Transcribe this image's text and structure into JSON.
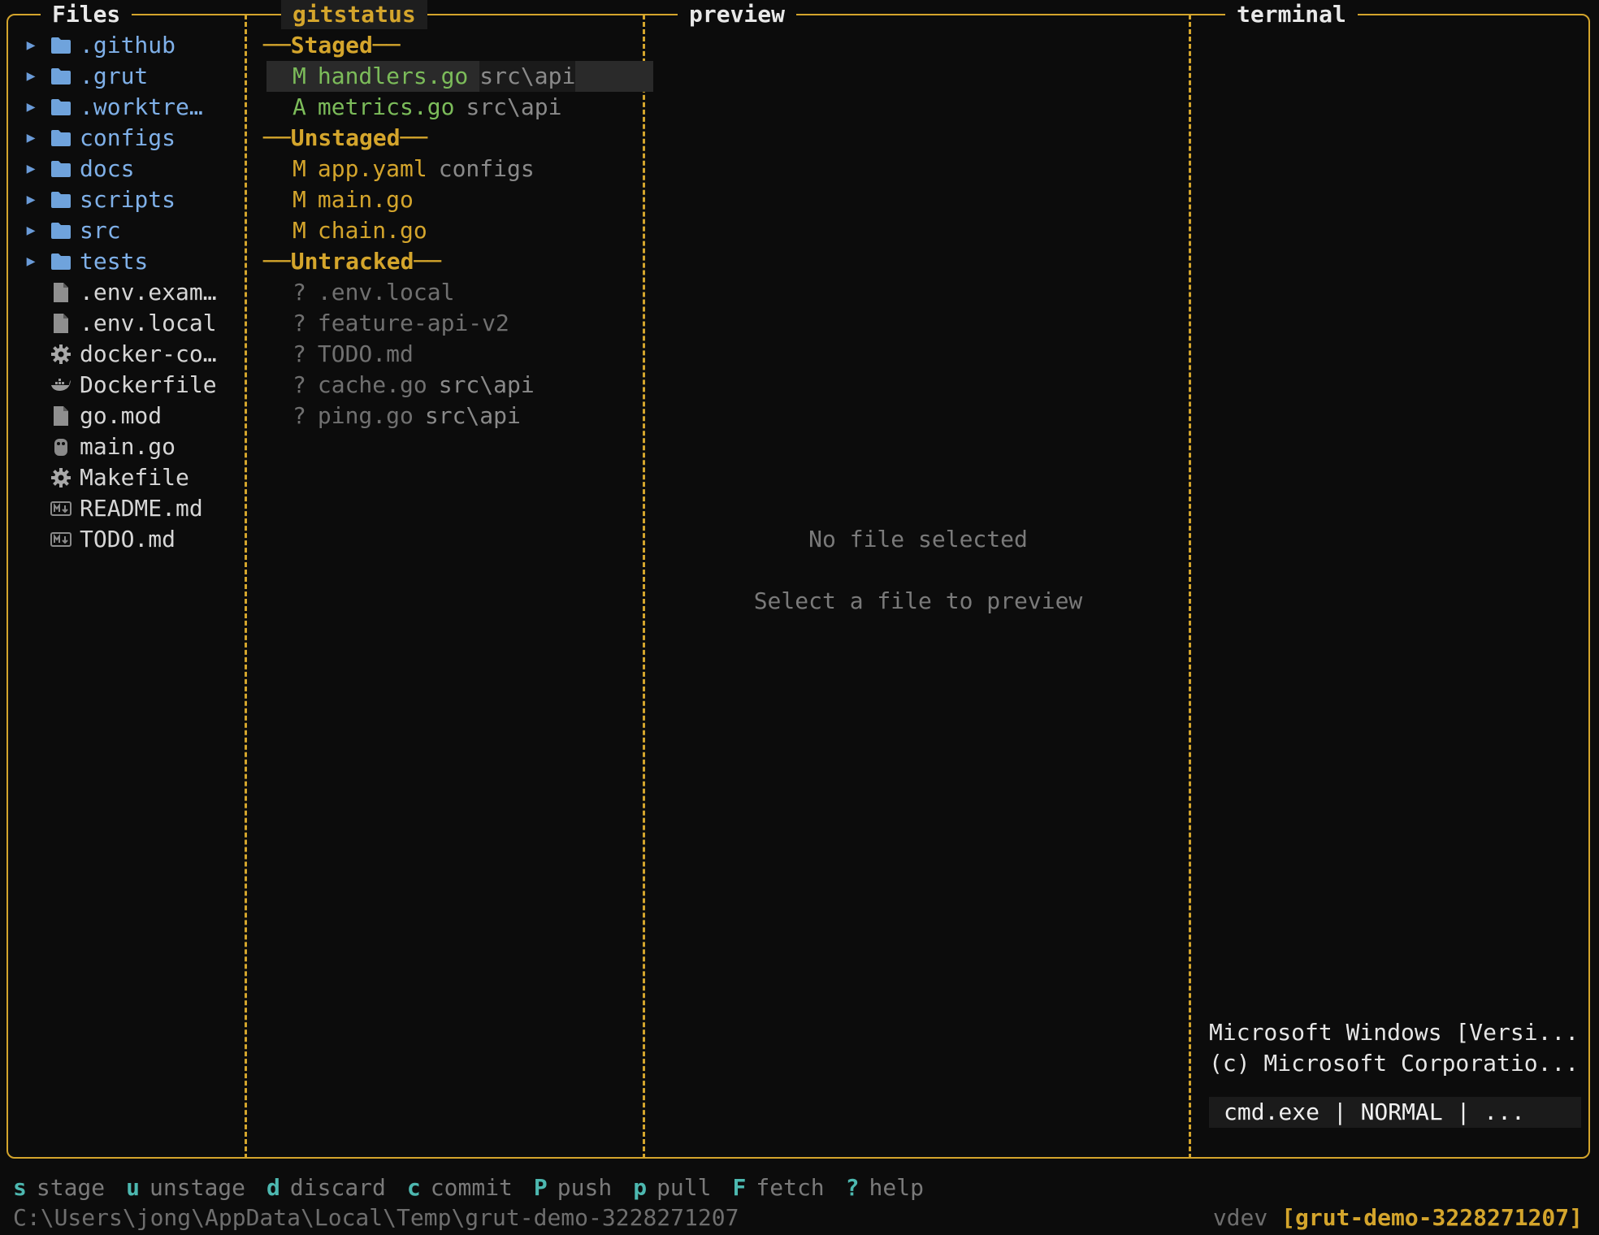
{
  "panes": {
    "files_title": "Files",
    "git_title": "gitstatus",
    "preview_title": "preview",
    "terminal_title": "terminal"
  },
  "files": [
    {
      "name": ".github",
      "kind": "dir",
      "icon": "folder-icon"
    },
    {
      "name": ".grut",
      "kind": "dir",
      "icon": "folder-icon"
    },
    {
      "name": ".worktre…",
      "kind": "dir",
      "icon": "folder-icon"
    },
    {
      "name": "configs",
      "kind": "dir",
      "icon": "folder-icon"
    },
    {
      "name": "docs",
      "kind": "dir",
      "icon": "folder-icon"
    },
    {
      "name": "scripts",
      "kind": "dir",
      "icon": "folder-icon"
    },
    {
      "name": "src",
      "kind": "dir",
      "icon": "folder-icon"
    },
    {
      "name": "tests",
      "kind": "dir",
      "icon": "folder-icon"
    },
    {
      "name": ".env.exam…",
      "kind": "file",
      "icon": "file-icon"
    },
    {
      "name": ".env.local",
      "kind": "file",
      "icon": "file-icon"
    },
    {
      "name": "docker-co…",
      "kind": "file",
      "icon": "gear-icon"
    },
    {
      "name": "Dockerfile",
      "kind": "file",
      "icon": "docker-icon"
    },
    {
      "name": "go.mod",
      "kind": "file",
      "icon": "file-icon"
    },
    {
      "name": "main.go",
      "kind": "file",
      "icon": "go-icon"
    },
    {
      "name": "Makefile",
      "kind": "file",
      "icon": "gear-icon"
    },
    {
      "name": "README.md",
      "kind": "file",
      "icon": "markdown-icon"
    },
    {
      "name": "TODO.md",
      "kind": "file",
      "icon": "markdown-icon"
    }
  ],
  "git": {
    "staged_header": "Staged",
    "unstaged_header": "Unstaged",
    "untracked_header": "Untracked",
    "staged": [
      {
        "status": "M",
        "name": "handlers.go",
        "path": "src\\api"
      },
      {
        "status": "A",
        "name": "metrics.go",
        "path": "src\\api"
      }
    ],
    "unstaged": [
      {
        "status": "M",
        "name": "app.yaml",
        "path": "configs"
      },
      {
        "status": "M",
        "name": "main.go",
        "path": ""
      },
      {
        "status": "M",
        "name": "chain.go",
        "path": ""
      }
    ],
    "untracked": [
      {
        "status": "?",
        "name": ".env.local",
        "path": ""
      },
      {
        "status": "?",
        "name": "feature-api-v2",
        "path": ""
      },
      {
        "status": "?",
        "name": "TODO.md",
        "path": ""
      },
      {
        "status": "?",
        "name": "cache.go",
        "path": "src\\api"
      },
      {
        "status": "?",
        "name": "ping.go",
        "path": "src\\api"
      }
    ]
  },
  "preview": {
    "empty_title": "No file selected",
    "empty_hint": "Select a file to preview"
  },
  "terminal": {
    "line1": "Microsoft Windows [Versi...",
    "line2": "(c) Microsoft Corporatio...",
    "status": "cmd.exe | NORMAL | ..."
  },
  "keybinds": [
    {
      "key": "s",
      "label": "stage"
    },
    {
      "key": "u",
      "label": "unstage"
    },
    {
      "key": "d",
      "label": "discard"
    },
    {
      "key": "c",
      "label": "commit"
    },
    {
      "key": "P",
      "label": "push"
    },
    {
      "key": "p",
      "label": "pull"
    },
    {
      "key": "F",
      "label": "fetch"
    },
    {
      "key": "?",
      "label": "help"
    }
  ],
  "statusbar": {
    "cwd": "C:\\Users\\jong\\AppData\\Local\\Temp\\grut-demo-3228271207",
    "version": "vdev",
    "branch": "[grut-demo-3228271207]"
  },
  "colors": {
    "accent": "#d4a52c",
    "staged": "#7cbc5a",
    "keybind": "#4db8b0",
    "folder": "#7fb0e8"
  }
}
